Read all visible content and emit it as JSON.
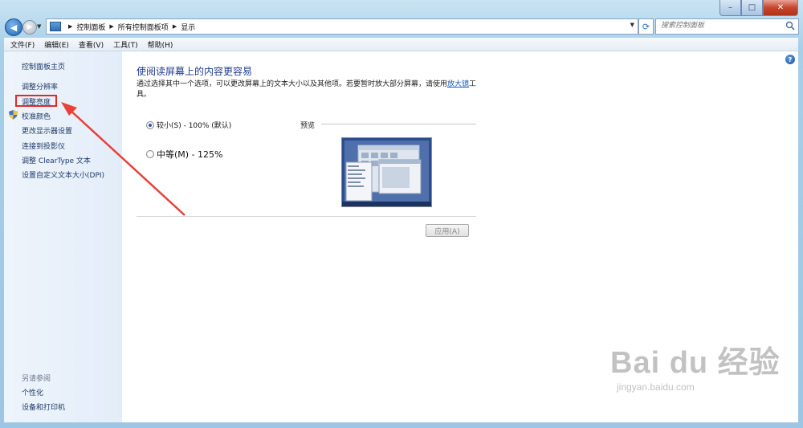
{
  "breadcrumb": [
    "控制面板",
    "所有控制面板项",
    "显示"
  ],
  "search": {
    "placeholder": "搜索控制面板"
  },
  "menu": [
    "文件(F)",
    "编辑(E)",
    "查看(V)",
    "工具(T)",
    "帮助(H)"
  ],
  "sidebar": {
    "home": "控制面板主页",
    "items": [
      "调整分辨率",
      "调整亮度",
      "校准颜色",
      "更改显示器设置",
      "连接到投影仪",
      "调整 ClearType 文本",
      "设置自定义文本大小(DPI)"
    ],
    "see_also_title": "另请参阅",
    "see_also": [
      "个性化",
      "设备和打印机"
    ]
  },
  "main": {
    "title": "使阅读屏幕上的内容更容易",
    "desc_before": "通过选择其中一个选项，可以更改屏幕上的文本大小以及其他项。若要暂时放大部分屏幕，请使用",
    "desc_link": "放大镜",
    "desc_after": "工具。",
    "options": [
      {
        "label": "较小(S) - 100% (默认)",
        "selected": true
      },
      {
        "label": "中等(M) - 125%",
        "selected": false
      }
    ],
    "preview_label": "预览",
    "apply_label": "应用(A)"
  },
  "watermark": {
    "brand": "Bai du 经验",
    "url": "jingyan.baidu.com"
  },
  "colors": {
    "accent": "#1e3c8c",
    "highlight": "#e02a2a"
  }
}
